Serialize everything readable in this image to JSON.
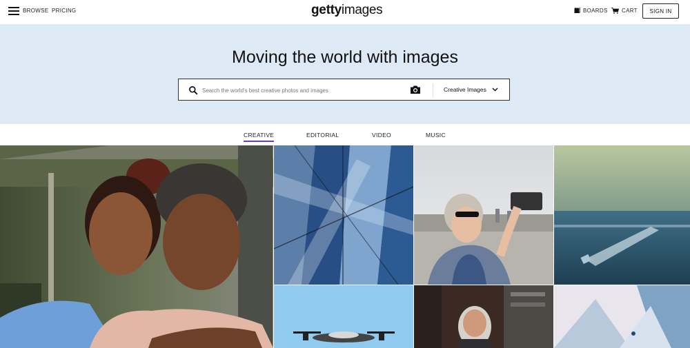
{
  "header": {
    "browse_label": "BROWSE",
    "pricing_label": "PRICING",
    "logo_bold": "getty",
    "logo_light": "images",
    "boards_label": "BOARDS",
    "cart_label": "CART",
    "signin_label": "SIGN IN"
  },
  "hero": {
    "title": "Moving the world with images",
    "search_placeholder": "Search the world's best creative photos and images",
    "scope_selected": "Creative Images"
  },
  "tabs": [
    {
      "label": "CREATIVE",
      "active": true
    },
    {
      "label": "EDITORIAL",
      "active": false
    },
    {
      "label": "VIDEO",
      "active": false
    },
    {
      "label": "MUSIC",
      "active": false
    }
  ],
  "colors": {
    "hero_bg": "#ddeaf5",
    "active_tab_underline": "#6b3fa0"
  },
  "icons": {
    "menu": "hamburger-icon",
    "search": "search-icon",
    "camera": "camera-icon",
    "chevron": "chevron-down-icon",
    "boards": "boards-icon",
    "cart": "cart-icon"
  }
}
